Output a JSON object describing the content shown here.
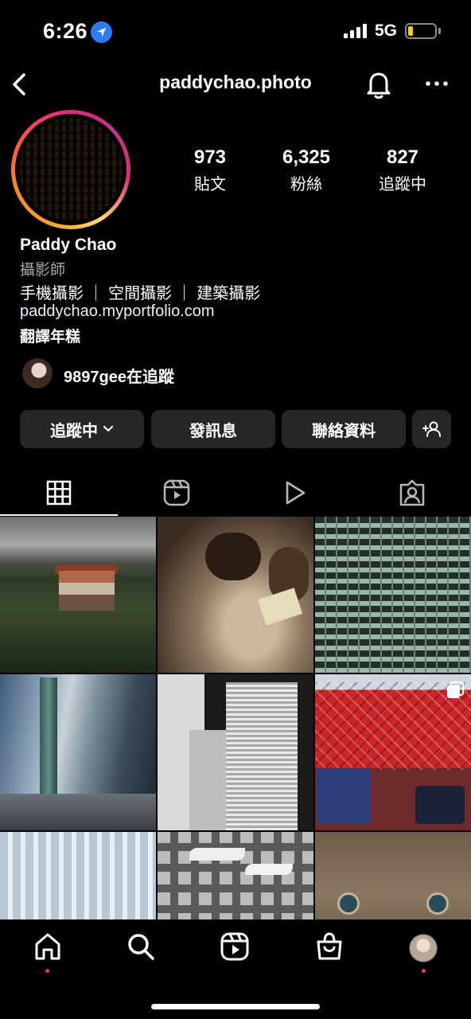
{
  "status_bar": {
    "time": "6:26",
    "network": "5G",
    "battery_level": 0.2,
    "battery_color": "#f5d000"
  },
  "header": {
    "username": "paddychao.photo",
    "icons": [
      "back-icon",
      "bell-icon",
      "more-icon"
    ]
  },
  "profile": {
    "stats": [
      {
        "value": "973",
        "label": "貼文"
      },
      {
        "value": "6,325",
        "label": "粉絲"
      },
      {
        "value": "827",
        "label": "追蹤中"
      }
    ],
    "name": "Paddy Chao",
    "category": "攝影師",
    "bio": "手機攝影 ｜ 空間攝影 ｜ 建築攝影",
    "link": "paddychao.myportfolio.com",
    "translate": "翻譯年糕",
    "followed_by": "9897gee在追蹤"
  },
  "actions": {
    "following": "追蹤中",
    "message": "發訊息",
    "contact": "聯絡資料"
  },
  "tabs": [
    "grid-icon",
    "reels-icon",
    "video-icon",
    "tagged-icon"
  ],
  "bottom_nav": [
    "home-icon",
    "search-icon",
    "reels-icon",
    "shop-icon",
    "profile-avatar"
  ],
  "colors": {
    "background": "#000000",
    "button": "#262626",
    "notification_dot": "#ff3040",
    "location_badge": "#2d7cf6"
  }
}
